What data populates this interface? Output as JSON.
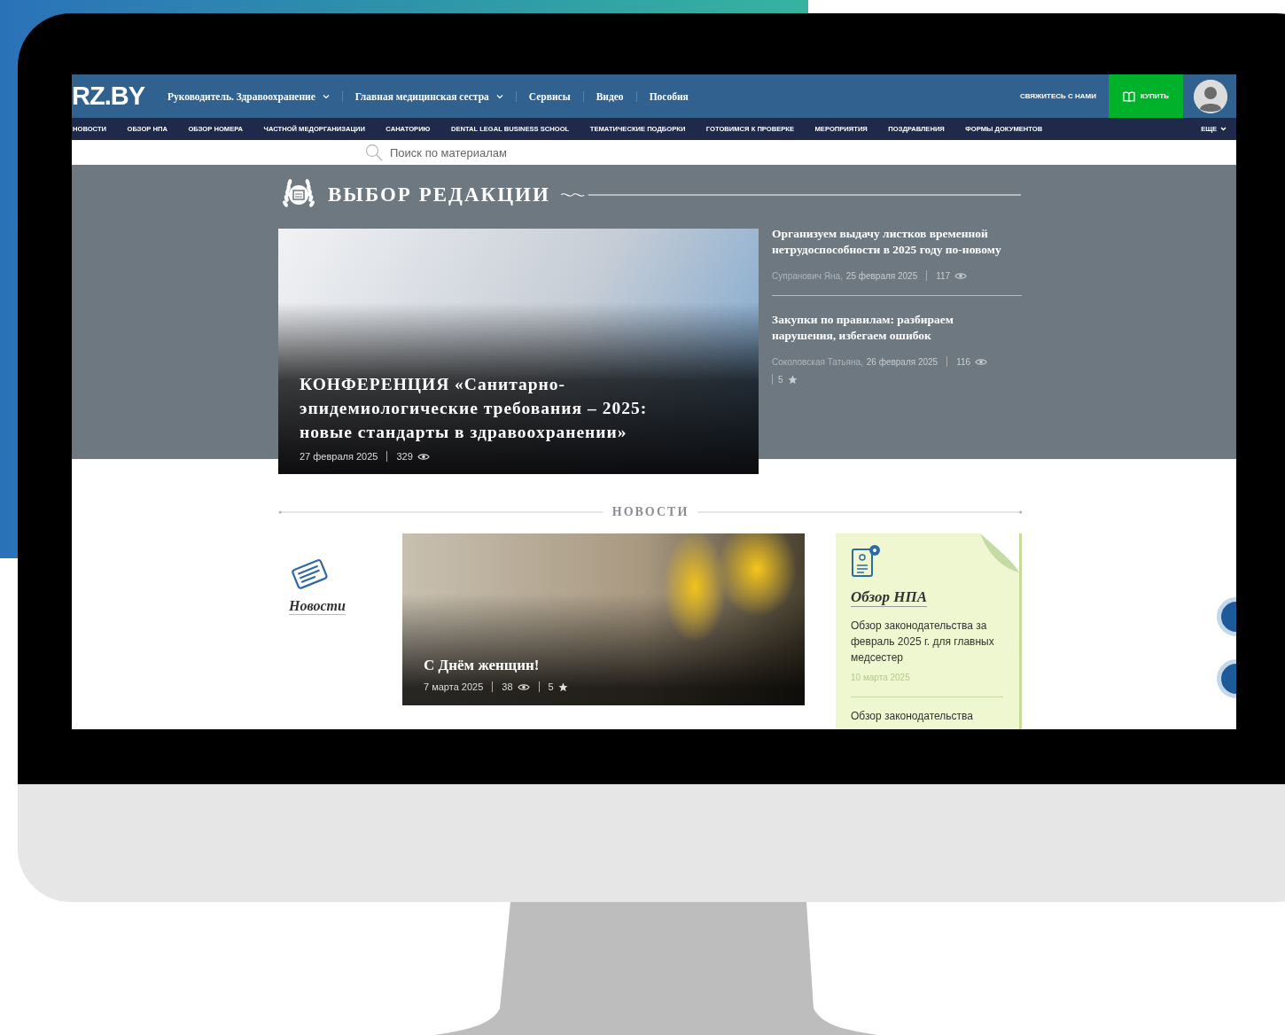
{
  "site": {
    "logo": "RZ.BY",
    "nav": [
      {
        "label": "Руководитель. Здравоохранение",
        "dropdown": true
      },
      {
        "label": "Главная медицинская сестра",
        "dropdown": true
      },
      {
        "label": "Сервисы",
        "dropdown": false
      },
      {
        "label": "Видео",
        "dropdown": false
      },
      {
        "label": "Пособия",
        "dropdown": false
      }
    ],
    "contact": "СВЯЖИТЕСЬ С НАМИ",
    "buy": "КУПИТЬ"
  },
  "categories": [
    "НОВОСТИ",
    "ОБЗОР НПА",
    "ОБЗОР НОМЕРА",
    "ЧАСТНОЙ МЕДОРГАНИЗАЦИИ",
    "САНАТОРИЮ",
    "DENTAL LEGAL BUSINESS SCHOOL",
    "ТЕМАТИЧЕСКИЕ ПОДБОРКИ",
    "ГОТОВИМСЯ К ПРОВЕРКЕ",
    "МЕРОПРИЯТИЯ",
    "ПОЗДРАВЛЕНИЯ",
    "ФОРМЫ ДОКУМЕНТОВ"
  ],
  "more": "ЕЩЕ",
  "search": {
    "placeholder": "Поиск по материалам"
  },
  "editors_choice": {
    "title": "ВЫБОР РЕДАКЦИИ",
    "featured": {
      "title": "КОНФЕРЕНЦИЯ «Санитарно-эпидемиологические требования – 2025: новые стандарты в здравоохранении»",
      "date": "27 февраля 2025",
      "views": "329"
    },
    "articles": [
      {
        "title": "Организуем выдачу листков временной нетрудоспособности в 2025 году по-новому",
        "author": "Супранович Яна,",
        "date": "25 февраля 2025",
        "views": "117"
      },
      {
        "title": "Закупки по правилам: разбираем нарушения, избегаем ошибок",
        "author": "Соколовская Татьяна,",
        "date": "26 февраля 2025",
        "views": "116",
        "rating": "5"
      }
    ]
  },
  "news": {
    "title": "НОВОСТИ",
    "section": "Новости",
    "featured": {
      "title": "С Днём женщин!",
      "date": "7 марта 2025",
      "views": "38",
      "rating": "5"
    },
    "npa": {
      "title": "Обзор НПА",
      "items": [
        {
          "text": "Обзор законодательства за февраль 2025 г. для главных медсестер",
          "date": "10 марта 2025"
        },
        {
          "text": "Обзор законодательства"
        }
      ]
    }
  }
}
